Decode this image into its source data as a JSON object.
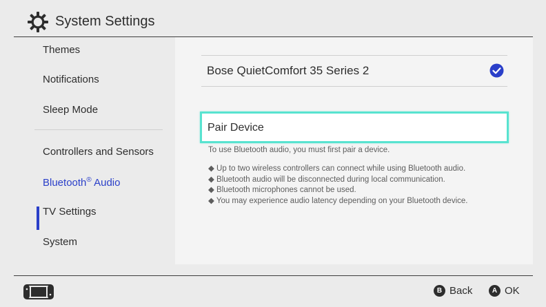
{
  "header": {
    "title": "System Settings",
    "icon": "gear-icon"
  },
  "sidebar": {
    "items": [
      {
        "label": "Themes"
      },
      {
        "label": "Notifications"
      },
      {
        "label": "Sleep Mode"
      },
      {
        "label": "Controllers and Sensors"
      },
      {
        "label": "Bluetooth",
        "sup": "®",
        "label_suffix": " Audio",
        "active": true
      },
      {
        "label": "TV Settings"
      },
      {
        "label": "System"
      }
    ],
    "accent_color": "#2a3fc9"
  },
  "main": {
    "device": {
      "name": "Bose QuietComfort 35 Series 2",
      "status_icon": "checkmark-circle-icon"
    },
    "pair_button": {
      "label": "Pair Device",
      "highlight_color": "#58e3d0"
    },
    "hint": "To use Bluetooth audio, you must first pair a device.",
    "notes": [
      "◆ Up to two wireless controllers can connect while using Bluetooth audio.",
      "◆ Bluetooth audio will be disconnected during local communication.",
      "◆ Bluetooth microphones cannot be used.",
      "◆ You may experience audio latency depending on your Bluetooth device."
    ]
  },
  "footer": {
    "console_icon": "console-icon",
    "back": {
      "button": "B",
      "label": "Back"
    },
    "ok": {
      "button": "A",
      "label": "OK"
    }
  }
}
